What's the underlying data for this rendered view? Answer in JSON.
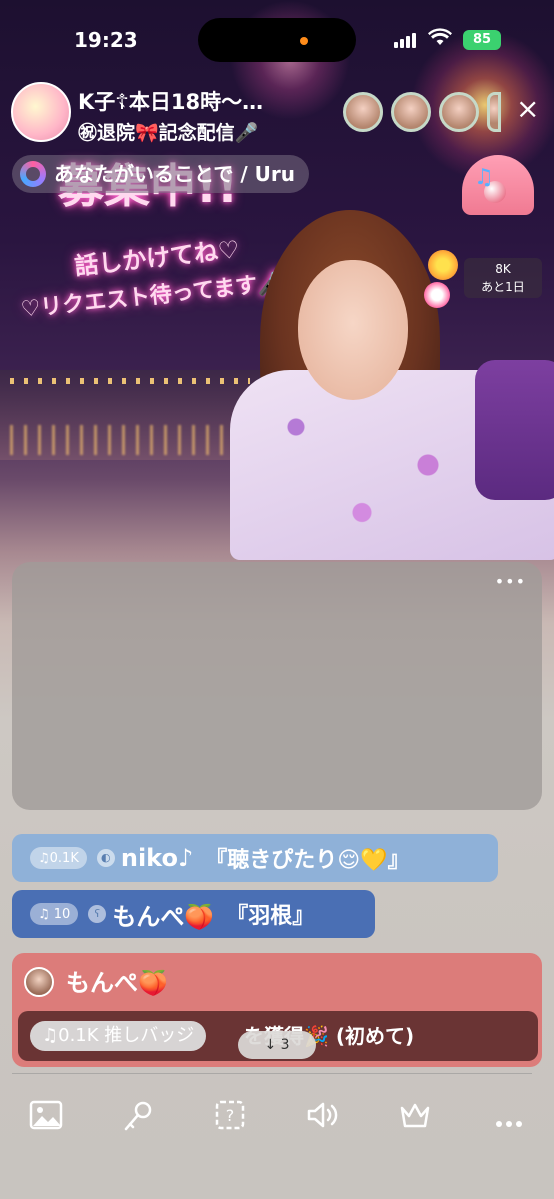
{
  "status_bar": {
    "time": "19:23",
    "battery": "85"
  },
  "header": {
    "title": "K子☦本日18時〜…",
    "subtitle": "㊗退院🎀記念配信🎤",
    "close_label": "×"
  },
  "song": {
    "label": "あなたがいることで / Uru"
  },
  "gift_counter": {
    "amount": "8K",
    "remaining": "あと1日"
  },
  "overlay_text": {
    "headline": "募集中!!",
    "line1": "話しかけてね♡",
    "line2": "♡リクエスト待ってます🎤"
  },
  "panel": {
    "more_label": "•••"
  },
  "comments": [
    {
      "badge": "♫0.1K",
      "name": "niko♪",
      "text": "『聴きぴたり😌💛』"
    },
    {
      "badge": "♫ 10",
      "name": "もんぺ🍑",
      "text": "『羽根』"
    }
  ],
  "event": {
    "name": "もんぺ🍑",
    "badge": "♫0.1K 推しバッジ",
    "text": "を獲得🎉 (初めて)"
  },
  "scroll_indicator": {
    "label": "↓ 3"
  },
  "toolbar": {
    "icons": [
      "image-icon",
      "microphone-icon",
      "quiz-icon",
      "speaker-icon",
      "crown-icon",
      "more-icon"
    ]
  },
  "colors": {
    "comment1_bg": "#8fb1d8",
    "comment2_bg": "#4a6fb4",
    "event_bg": "#dc7c7a",
    "event_inner_bg": "#6a3434",
    "battery": "#3bd16f"
  }
}
